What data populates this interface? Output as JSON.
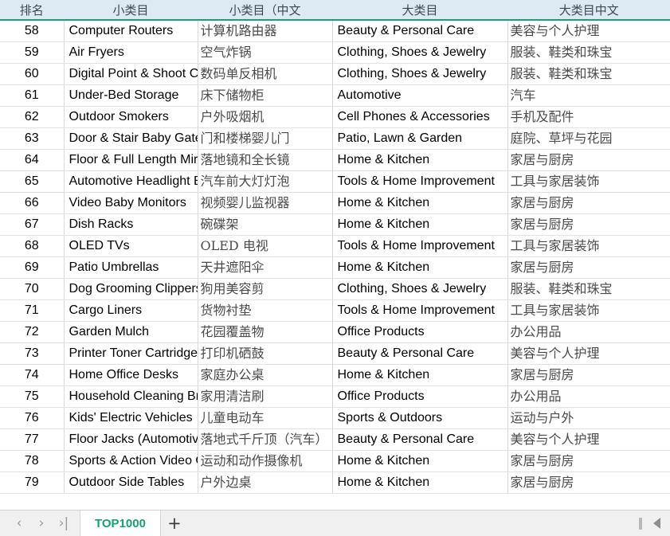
{
  "app": {
    "type": "spreadsheet",
    "accent_color": "#17a074",
    "header_bg": "#dde9f3",
    "header_rule_color": "#18a07a"
  },
  "table": {
    "columns": [
      {
        "key": "rank",
        "label": "排名",
        "align": "center"
      },
      {
        "key": "sub",
        "label": "小类目",
        "align": "center"
      },
      {
        "key": "subcn",
        "label": "小类目（中文",
        "align": "center"
      },
      {
        "key": "main",
        "label": "大类目",
        "align": "center"
      },
      {
        "key": "maincn",
        "label": "大类目中文",
        "align": "center"
      }
    ],
    "rows": [
      {
        "rank": "58",
        "sub": "Computer Routers",
        "subcn": "计算机路由器",
        "main": "Beauty & Personal Care",
        "maincn": "美容与个人护理"
      },
      {
        "rank": "59",
        "sub": "Air Fryers",
        "subcn": "空气炸锅",
        "main": "Clothing, Shoes & Jewelry",
        "maincn": "服装、鞋类和珠宝"
      },
      {
        "rank": "60",
        "sub": "Digital Point & Shoot Cameras",
        "subcn": "数码单反相机",
        "main": "Clothing, Shoes & Jewelry",
        "maincn": "服装、鞋类和珠宝"
      },
      {
        "rank": "61",
        "sub": "Under-Bed Storage",
        "subcn": "床下储物柜",
        "main": "Automotive",
        "maincn": "汽车"
      },
      {
        "rank": "62",
        "sub": "Outdoor Smokers",
        "subcn": "户外吸烟机",
        "main": "Cell Phones & Accessories",
        "maincn": "手机及配件"
      },
      {
        "rank": "63",
        "sub": "Door & Stair Baby Gates",
        "subcn": "门和楼梯婴儿门",
        "main": "Patio, Lawn & Garden",
        "maincn": "庭院、草坪与花园"
      },
      {
        "rank": "64",
        "sub": "Floor & Full Length Mirrors",
        "subcn": "落地镜和全长镜",
        "main": "Home & Kitchen",
        "maincn": "家居与厨房"
      },
      {
        "rank": "65",
        "sub": "Automotive Headlight Bulbs",
        "subcn": "汽车前大灯灯泡",
        "main": "Tools & Home Improvement",
        "maincn": "工具与家居装饰"
      },
      {
        "rank": "66",
        "sub": "Video Baby Monitors",
        "subcn": "视频婴儿监视器",
        "main": "Home & Kitchen",
        "maincn": "家居与厨房"
      },
      {
        "rank": "67",
        "sub": "Dish Racks",
        "subcn": "碗碟架",
        "main": "Home & Kitchen",
        "maincn": "家居与厨房"
      },
      {
        "rank": "68",
        "sub": "OLED TVs",
        "subcn": "OLED 电视",
        "main": "Tools & Home Improvement",
        "maincn": "工具与家居装饰"
      },
      {
        "rank": "69",
        "sub": "Patio Umbrellas",
        "subcn": "天井遮阳伞",
        "main": "Home & Kitchen",
        "maincn": "家居与厨房"
      },
      {
        "rank": "70",
        "sub": "Dog Grooming Clippers",
        "subcn": "狗用美容剪",
        "main": "Clothing, Shoes & Jewelry",
        "maincn": "服装、鞋类和珠宝"
      },
      {
        "rank": "71",
        "sub": "Cargo Liners",
        "subcn": "货物衬垫",
        "main": "Tools & Home Improvement",
        "maincn": "工具与家居装饰"
      },
      {
        "rank": "72",
        "sub": "Garden Mulch",
        "subcn": "花园覆盖物",
        "main": "Office Products",
        "maincn": "办公用品"
      },
      {
        "rank": "73",
        "sub": "Printer Toner Cartridges",
        "subcn": "打印机硒鼓",
        "main": "Beauty & Personal Care",
        "maincn": "美容与个人护理"
      },
      {
        "rank": "74",
        "sub": "Home Office Desks",
        "subcn": "家庭办公桌",
        "main": "Home & Kitchen",
        "maincn": "家居与厨房"
      },
      {
        "rank": "75",
        "sub": "Household Cleaning Brushes",
        "subcn": "家用清洁刷",
        "main": "Office Products",
        "maincn": "办公用品"
      },
      {
        "rank": "76",
        "sub": "Kids' Electric Vehicles",
        "subcn": "儿童电动车",
        "main": "Sports & Outdoors",
        "maincn": "运动与户外"
      },
      {
        "rank": "77",
        "sub": "Floor Jacks (Automotive)",
        "subcn": "落地式千斤顶（汽车）",
        "main": "Beauty & Personal Care",
        "maincn": "美容与个人护理"
      },
      {
        "rank": "78",
        "sub": "Sports & Action Video Cameras",
        "subcn": "运动和动作摄像机",
        "main": "Home & Kitchen",
        "maincn": "家居与厨房"
      },
      {
        "rank": "79",
        "sub": "Outdoor Side Tables",
        "subcn": "户外边桌",
        "main": "Home & Kitchen",
        "maincn": "家居与厨房"
      }
    ]
  },
  "tabbar": {
    "nav": [
      {
        "name": "prev-sheet",
        "glyph": "‹"
      },
      {
        "name": "next-sheet",
        "glyph": "›"
      },
      {
        "name": "last-sheet",
        "glyph": "›|"
      }
    ],
    "sheets": [
      {
        "label": "TOP1000",
        "active": true
      }
    ],
    "add_label": "+"
  }
}
